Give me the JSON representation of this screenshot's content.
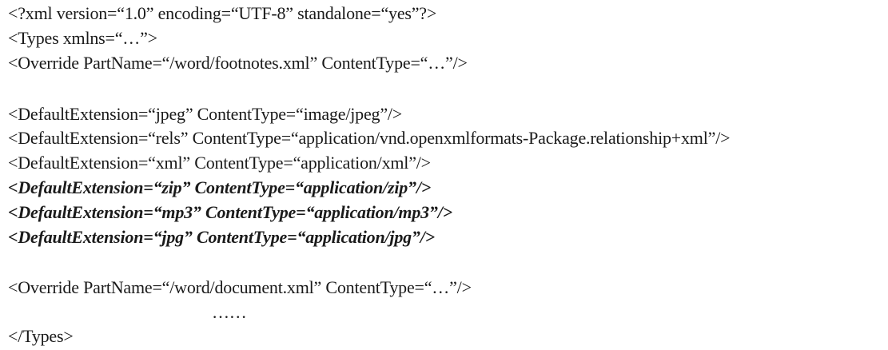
{
  "document": {
    "lines": [
      {
        "text": "<?xml version=“1.0” encoding=“UTF-8” standalone=“yes”?>",
        "style": "normal"
      },
      {
        "text": "<Types xmlns=“…”>",
        "style": "normal"
      },
      {
        "text": "<Override PartName=“/word/footnotes.xml” ContentType=“…”/>",
        "style": "normal"
      },
      {
        "text": "<DefaultExtension=“jpeg” ContentType=“image/jpeg”/>",
        "style": "normal"
      },
      {
        "text": "<DefaultExtension=“rels” ContentType=“application/vnd.openxmlformats-Package.relationship+xml”/>",
        "style": "normal"
      },
      {
        "text": "<DefaultExtension=“xml” ContentType=“application/xml”/>",
        "style": "normal"
      },
      {
        "text": "<DefaultExtension=“zip” ContentType=“application/zip”/>",
        "style": "bold-italic"
      },
      {
        "text": "<DefaultExtension=“mp3” ContentType=“application/mp3”/>",
        "style": "bold-italic"
      },
      {
        "text": "<DefaultExtension=“jpg” ContentType=“application/jpg”/>",
        "style": "bold-italic"
      },
      {
        "text": "<Override PartName=“/word/document.xml” ContentType=“…”/>",
        "style": "normal"
      },
      {
        "text": "……",
        "style": "normal"
      },
      {
        "text": "</Types>",
        "style": "normal"
      }
    ]
  }
}
